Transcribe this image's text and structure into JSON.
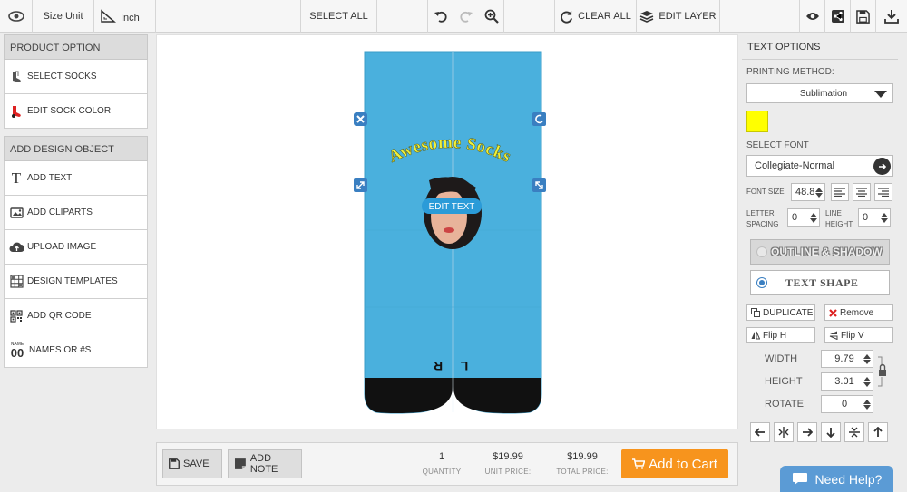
{
  "toolbar": {
    "size_unit_label": "Size Unit",
    "unit_value": "Inch",
    "select_all": "SELECT ALL",
    "clear_all": "CLEAR ALL",
    "edit_layer": "EDIT LAYER"
  },
  "left_panel": {
    "product_option_header": "PRODUCT OPTION",
    "product_items": [
      {
        "label": "SELECT SOCKS",
        "icon": "socks-icon"
      },
      {
        "label": "EDIT SOCK COLOR",
        "icon": "sock-color-icon"
      }
    ],
    "design_header": "ADD DESIGN OBJECT",
    "design_items": [
      {
        "label": "ADD TEXT",
        "icon": "text-icon"
      },
      {
        "label": "ADD CLIPARTS",
        "icon": "clipart-icon"
      },
      {
        "label": "UPLOAD IMAGE",
        "icon": "cloud-upload-icon"
      },
      {
        "label": "DESIGN TEMPLATES",
        "icon": "template-grid-icon"
      },
      {
        "label": "ADD QR CODE",
        "icon": "qr-code-icon"
      },
      {
        "label": "NAMES OR #S",
        "icon": "names-numbers-icon"
      }
    ],
    "names_icon_small": "NAME",
    "names_icon_big": "00"
  },
  "canvas": {
    "design_text": "Awesome Socks",
    "edit_text_label": "EDIT TEXT",
    "left_sock_letter": "R",
    "right_sock_letter": "L",
    "sock_color": "#4ab0dd",
    "toe_color": "#111111",
    "text_color": "#f0f03a"
  },
  "bottom_bar": {
    "save": "SAVE",
    "add_note": "ADD NOTE",
    "quantity": "1",
    "quantity_label": "QUANTITY",
    "unit_price": "$19.99",
    "unit_price_label": "UNIT PRICE:",
    "total_price": "$19.99",
    "total_price_label": "TOTAL PRICE:",
    "add_to_cart": "Add to Cart"
  },
  "right_panel": {
    "title": "TEXT OPTIONS",
    "printing_method_label": "PRINTING METHOD:",
    "printing_method_value": "Sublimation",
    "text_color_swatch": "#ffff00",
    "select_font_label": "SELECT FONT",
    "font_value": "Collegiate-Normal",
    "font_size_label": "FONT SIZE",
    "font_size_value": "48.8",
    "letter_spacing_label_1": "LETTER",
    "letter_spacing_label_2": "SPACING",
    "letter_spacing_value": "0",
    "line_height_label_1": "LINE",
    "line_height_label_2": "HEIGHT",
    "line_height_value": "0",
    "outline_shadow_1": "OUTLINE",
    "outline_shadow_amp": "&",
    "outline_shadow_2": "SHADOW",
    "text_shape": "TEXT SHAPE",
    "duplicate": "DUPLICATE",
    "remove": "Remove",
    "flip_h": "Flip H",
    "flip_v": "Flip V",
    "width_label": "WIDTH",
    "width_value": "9.79",
    "height_label": "HEIGHT",
    "height_value": "3.01",
    "rotate_label": "ROTATE",
    "rotate_value": "0"
  },
  "need_help": "Need Help?",
  "colors": {
    "accent_orange": "#f7941d",
    "accent_blue": "#3a7fc1",
    "help_blue": "#5b9bd5"
  }
}
